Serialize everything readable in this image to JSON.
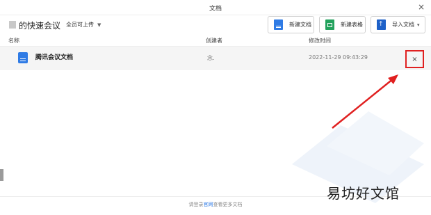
{
  "window": {
    "title": "文档",
    "close_glyph": "×"
  },
  "header": {
    "meeting_title": "的快速会议",
    "permission_label": "全员可上传",
    "permission_caret": "▼",
    "buttons": {
      "new_doc": "新建文档",
      "new_sheet": "新建表格",
      "import_doc": "导入文档",
      "import_caret": "▾"
    }
  },
  "table": {
    "columns": {
      "name": "名称",
      "creator": "创建者",
      "modified": "修改时间"
    },
    "rows": [
      {
        "name": "腾讯会议文档",
        "creator": "念.",
        "modified": "2022-11-29 09:43:29",
        "delete_glyph": "×"
      }
    ]
  },
  "footer": {
    "prefix": "请登录",
    "link": "官网",
    "suffix": "查看更多文档"
  },
  "watermark": "易坊好文馆",
  "icons": {
    "doc": "document-icon",
    "sheet": "spreadsheet-icon",
    "import": "upload-icon",
    "close": "close-icon",
    "delete": "delete-icon"
  },
  "colors": {
    "doc_blue": "#2f7be5",
    "sheet_green": "#23a25d",
    "import_navy": "#1e61c8",
    "highlight_red": "#e02020",
    "row_bg": "#f5f5f5"
  }
}
